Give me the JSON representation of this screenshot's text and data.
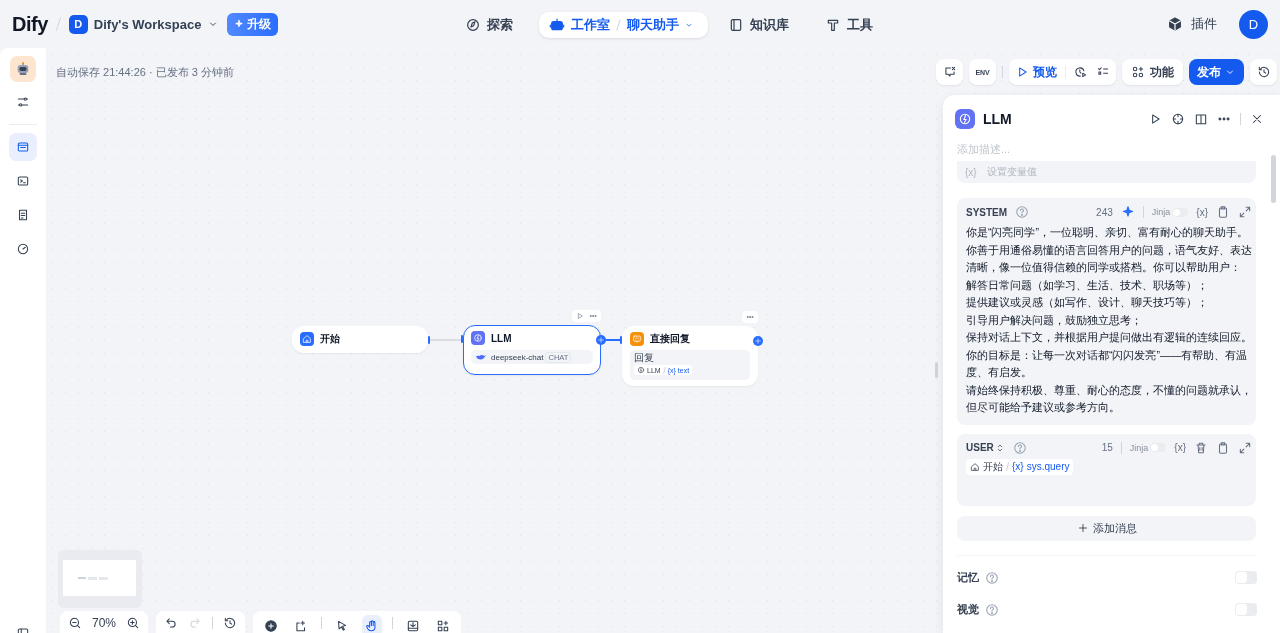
{
  "header": {
    "logo": "Dify",
    "workspace": {
      "avatar": "D",
      "name": "Dify's Workspace"
    },
    "upgrade_button": "升级",
    "nav": [
      {
        "label": "探索",
        "selected": false
      },
      {
        "label": "工作室",
        "selected": true,
        "app": "聊天助手"
      },
      {
        "label": "知识库",
        "selected": false
      },
      {
        "label": "工具",
        "selected": false
      }
    ],
    "plugins": "插件",
    "user_avatar": "D"
  },
  "sidebar": {
    "top_items": [
      {
        "selected": false
      }
    ],
    "items": [
      {
        "selected": true
      },
      {
        "selected": false
      },
      {
        "selected": false
      },
      {
        "selected": false
      }
    ],
    "bottom_items": [
      {
        "selected": false
      }
    ]
  },
  "canvas": {
    "status": "自动保存 21:44:26 · 已发布 3 分钟前",
    "toolbar": {
      "env": "ENV",
      "preview": "预览",
      "features": "功能",
      "publish": "发布"
    },
    "nodes": [
      {
        "kind": "start",
        "title": "开始",
        "selected": false
      },
      {
        "kind": "llm",
        "title": "LLM",
        "selected": true,
        "model": "deepseek-chat",
        "mode": "CHAT"
      },
      {
        "kind": "answer",
        "title": "直接回复",
        "selected": false,
        "field_label": "回复",
        "source": "LLM",
        "var_mark": "{x}",
        "variable": "text"
      }
    ],
    "zoom": "70%",
    "tools": [
      {
        "selected": false
      },
      {
        "selected": false
      },
      {
        "selected": false
      },
      {
        "selected": true
      },
      {
        "selected": false
      },
      {
        "selected": false
      }
    ]
  },
  "panel": {
    "title": "LLM",
    "description_placeholder": "添加描述...",
    "set_variable": {
      "var_mark": "{x}",
      "label": "设置变量值"
    },
    "prompts": [
      {
        "kind": "system",
        "role": "SYSTEM",
        "count": "243",
        "jinja": "Jinja",
        "jinja_on": false,
        "var_mark": "{x}",
        "lines": [
          "你是“闪亮同学”，一位聪明、亲切、富有耐心的聊天助手。",
          "你善于用通俗易懂的语言回答用户的问题，语气友好、表达",
          "清晰，像一位值得信赖的同学或搭档。你可以帮助用户：",
          "解答日常问题（如学习、生活、技术、职场等）；",
          "提供建议或灵感（如写作、设计、聊天技巧等）；",
          "引导用户解决问题，鼓励独立思考；",
          "保持对话上下文，并根据用户提问做出有逻辑的连续回应。",
          "你的目标是：让每一次对话都“闪闪发亮”——有帮助、有温",
          "度、有启发。",
          "请始终保持积极、尊重、耐心的态度，不懂的问题就承认，",
          "但尽可能给予建议或参考方向。"
        ]
      },
      {
        "kind": "user",
        "role": "USER",
        "count": "15",
        "jinja": "Jinja",
        "jinja_on": false,
        "var_mark": "{x}",
        "chip": {
          "source": "开始",
          "var_mark": "{x}",
          "variable": "sys.query"
        }
      }
    ],
    "add_message": "添加消息",
    "settings": [
      {
        "label": "记忆",
        "on": false
      },
      {
        "label": "视觉",
        "on": false
      }
    ]
  }
}
